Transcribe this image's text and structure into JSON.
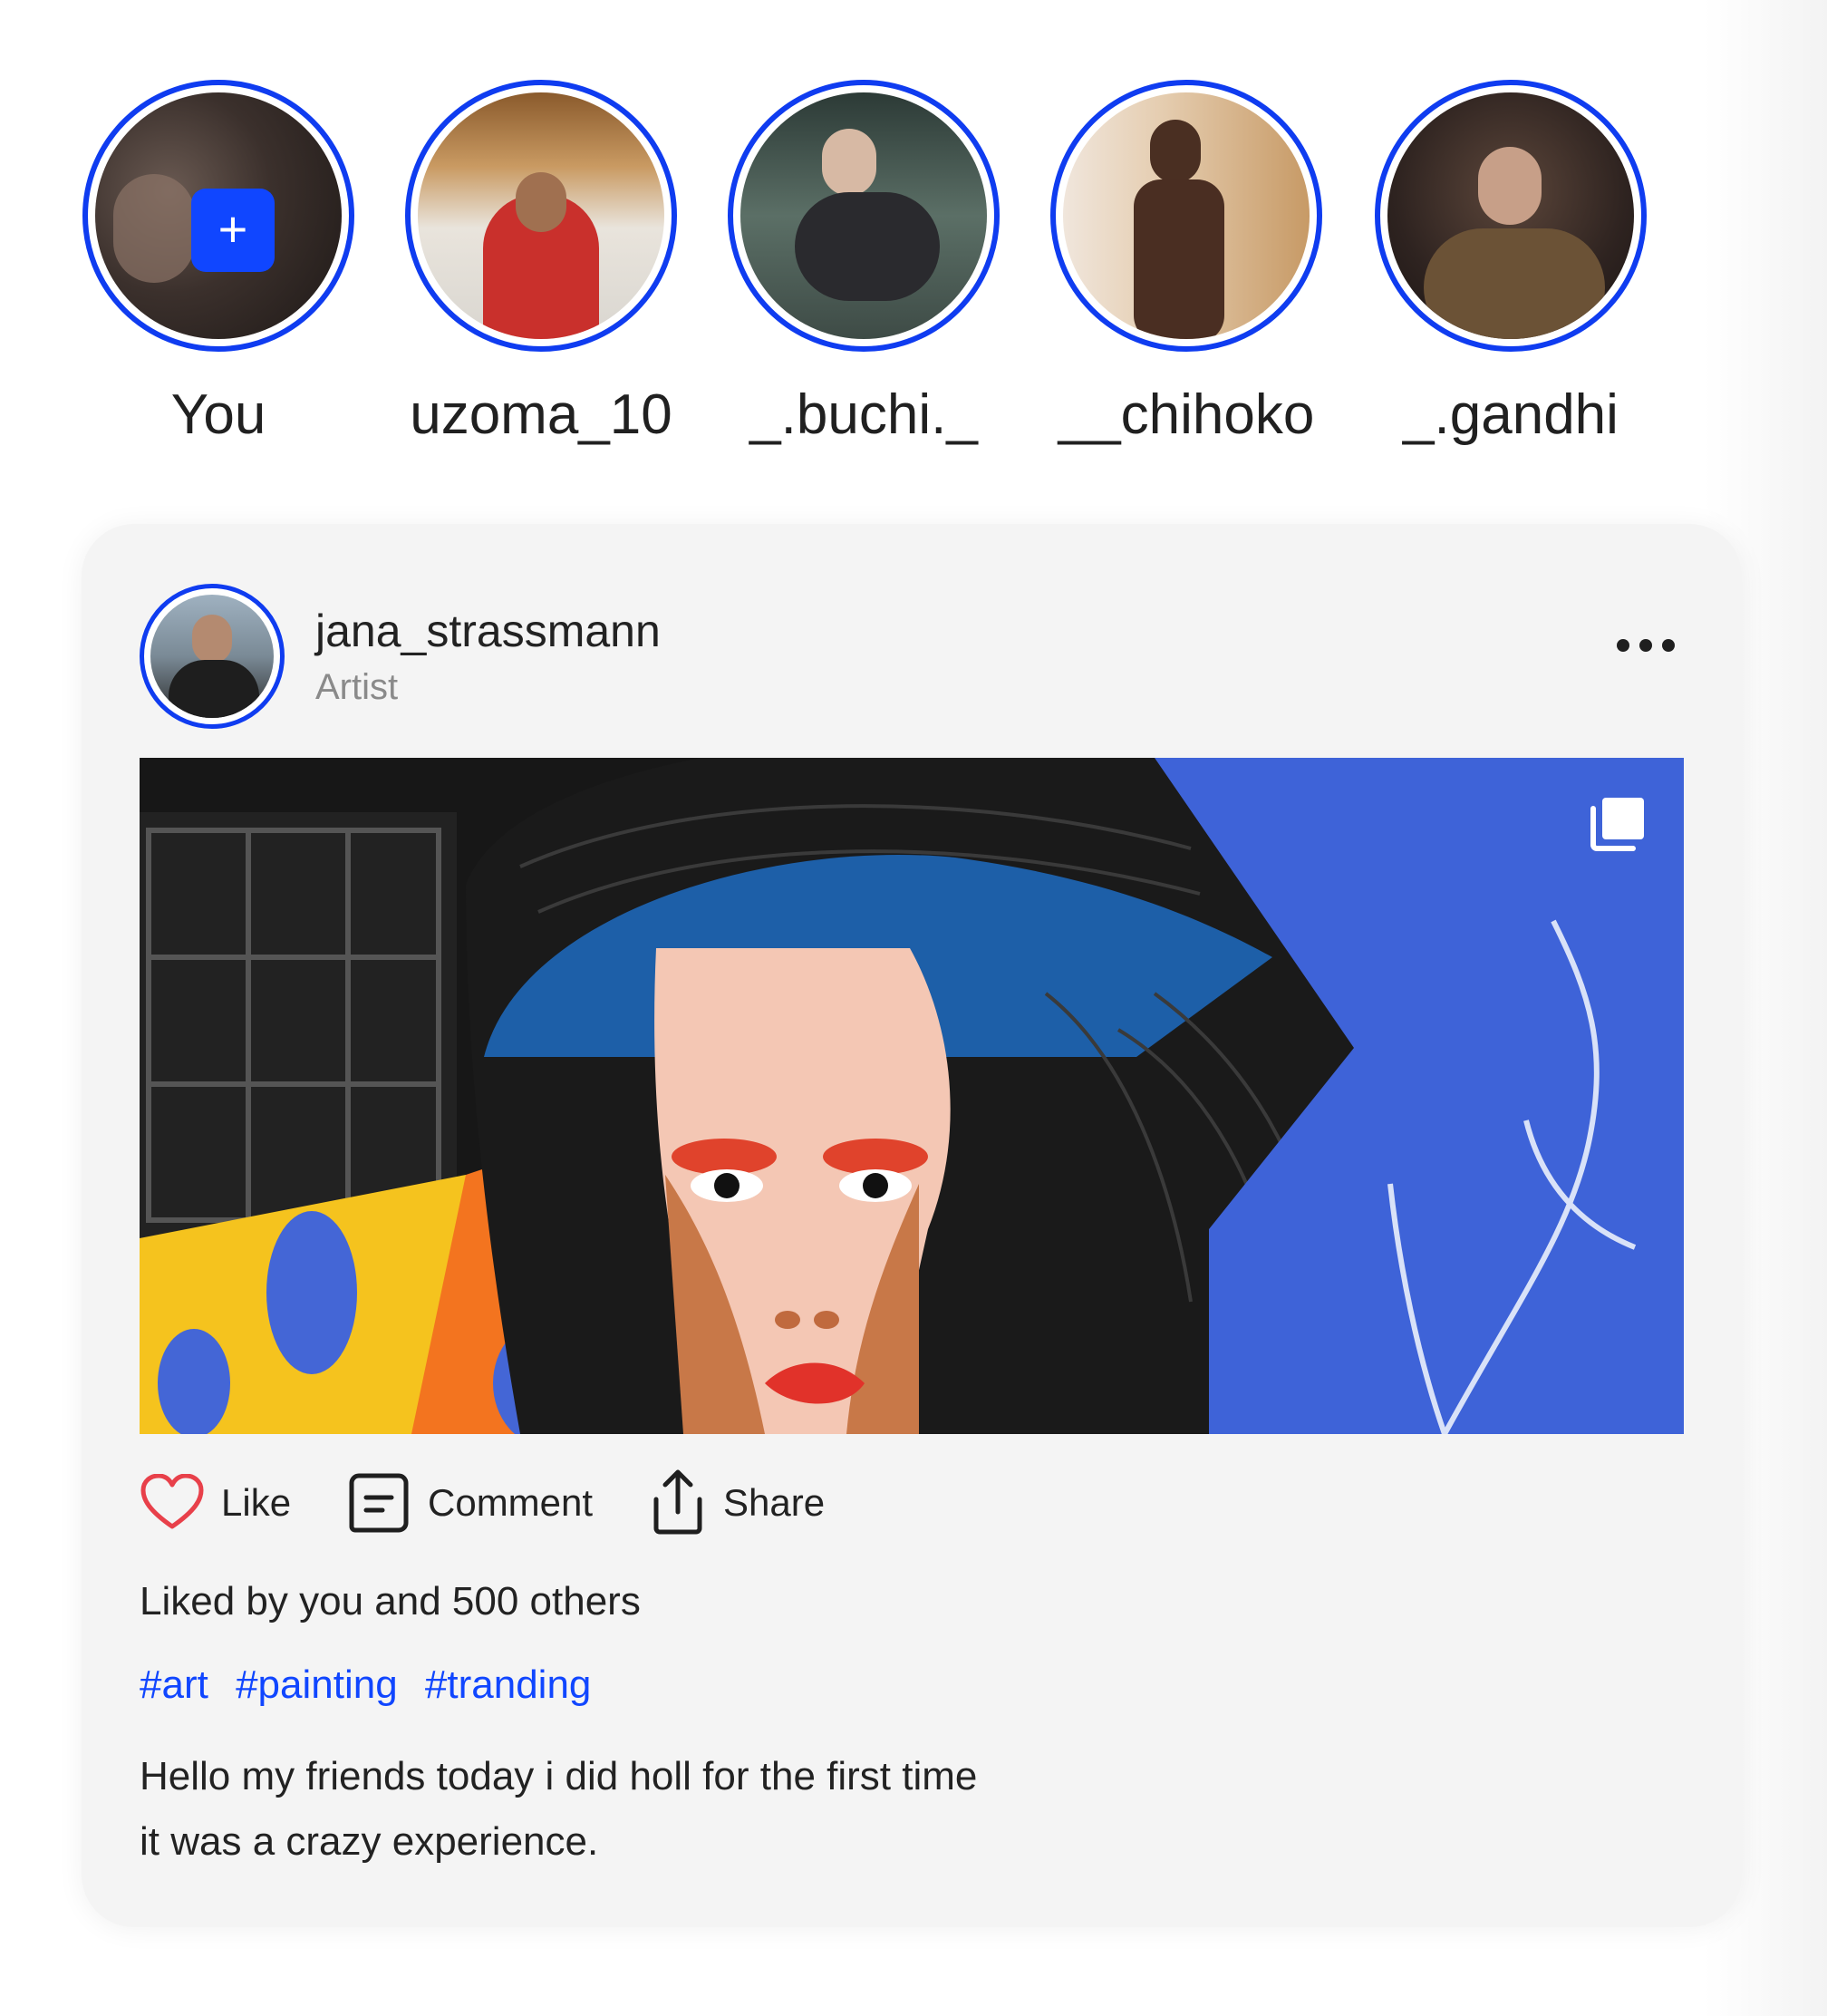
{
  "stories": [
    {
      "label": "You",
      "is_own": true,
      "add_symbol": "+"
    },
    {
      "label": "uzoma_10",
      "is_own": false
    },
    {
      "label": "_.buchi._",
      "is_own": false
    },
    {
      "label": "__chihoko",
      "is_own": false
    },
    {
      "label": "_.gandhi",
      "is_own": false
    }
  ],
  "post": {
    "author": {
      "name": "jana_strassmann",
      "role": "Artist"
    },
    "menu_icon": "more-horizontal-icon",
    "image_badge_icon": "multiple-images-icon",
    "actions": [
      {
        "label": "Like",
        "icon": "heart-icon"
      },
      {
        "label": "Comment",
        "icon": "comment-icon"
      },
      {
        "label": "Share",
        "icon": "share-icon"
      }
    ],
    "likes_text": "Liked by you and 500 others",
    "hashtags": [
      "#art",
      "#painting",
      "#tranding"
    ],
    "caption_lines": [
      "Hello my friends today i did holl for the first time",
      "it was a crazy experience."
    ]
  },
  "colors": {
    "accent": "#0f3cf0",
    "hashtag": "#1046ff",
    "like": "#e8404a"
  }
}
